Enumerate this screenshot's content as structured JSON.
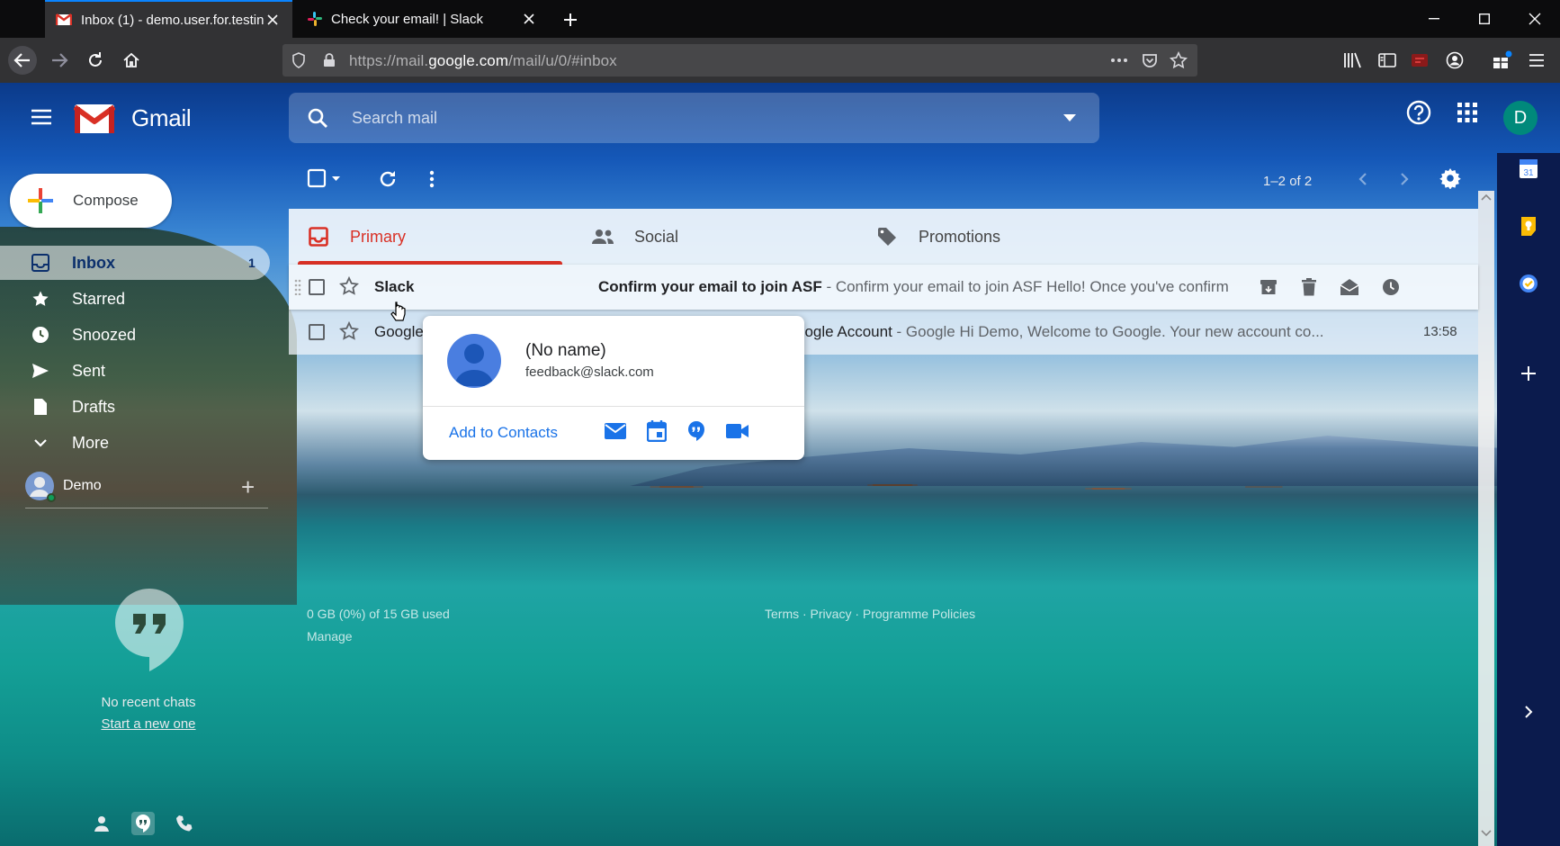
{
  "browser": {
    "tabs": [
      {
        "title": "Inbox (1) - demo.user.for.testing",
        "active": true
      },
      {
        "title": "Check your email! | Slack",
        "active": false
      }
    ],
    "url_prefix": "https://mail.",
    "url_domain": "google.com",
    "url_path": "/mail/u/0/#inbox"
  },
  "gmail": {
    "wordmark": "Gmail",
    "search_placeholder": "Search mail",
    "avatar_letter": "D",
    "compose_label": "Compose",
    "nav": [
      {
        "label": "Inbox",
        "count": "1",
        "icon": "inbox-icon"
      },
      {
        "label": "Starred",
        "count": "",
        "icon": "star-icon"
      },
      {
        "label": "Snoozed",
        "count": "",
        "icon": "clock-icon"
      },
      {
        "label": "Sent",
        "count": "",
        "icon": "send-icon"
      },
      {
        "label": "Drafts",
        "count": "",
        "icon": "draft-icon"
      },
      {
        "label": "More",
        "count": "",
        "icon": "chevron-down-icon"
      }
    ],
    "user_name": "Demo",
    "no_chats": "No recent chats",
    "start_new": "Start a new one",
    "pager": "1–2 of 2",
    "categories": [
      {
        "label": "Primary",
        "icon": "inbox-icon"
      },
      {
        "label": "Social",
        "icon": "people-icon"
      },
      {
        "label": "Promotions",
        "icon": "tag-icon"
      }
    ],
    "emails": [
      {
        "sender": "Slack",
        "subject": "Confirm your email to join ASF",
        "snippet": " - Confirm your email to join ASF Hello! Once you've confirmed...",
        "time": ""
      },
      {
        "sender": "Google",
        "subject": "oogle Account",
        "snippet": " - Google Hi Demo, Welcome to Google. Your new account co...",
        "time": "13:58"
      }
    ],
    "contact_card": {
      "name": "(No name)",
      "email": "feedback@slack.com",
      "add_label": "Add to Contacts"
    },
    "storage": "0 GB (0%) of 15 GB used",
    "manage": "Manage",
    "legal": "Terms · Privacy · Programme Policies",
    "calendar_day": "31"
  },
  "colors": {
    "accent_red": "#d93025",
    "link_blue": "#1a73e8",
    "avatar_teal": "#00897b",
    "firefox_blue": "#0a84ff"
  }
}
